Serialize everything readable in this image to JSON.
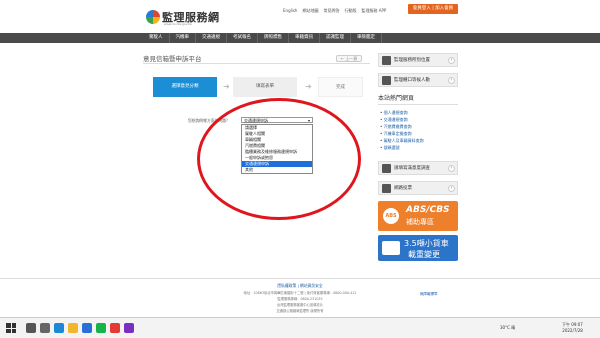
{
  "header": {
    "logo_text": "監理服務網",
    "logo_sub": "www.mvdis.gov.tw",
    "top_links": [
      "English",
      "網站地圖",
      "常見問答",
      "行動版",
      "監理服務 APP"
    ],
    "member_button": "會員登入 | 加入會員"
  },
  "nav": {
    "items": [
      "駕駛人",
      "汽機車",
      "交通違規",
      "考試報名",
      "牌照標售",
      "車籍資訊",
      "認識監理",
      "車險鑑定"
    ]
  },
  "main": {
    "title": "意見信箱暨申訴平台",
    "back_button": "← 上一頁",
    "steps": [
      "選擇意見分類",
      "填寫表單",
      "完成"
    ],
    "form_label": "您想詢問哪方面的問題？",
    "select_value": "交通違規申訴",
    "dropdown_options": [
      "請選擇",
      "駕駛人相關",
      "車輛相關",
      "汽燃費相關",
      "臨櫃業務及維修服務違規申訴",
      "一般申訴或抱怨",
      "交通違規申訴",
      "其他"
    ],
    "selected_index": 6
  },
  "sidebar": {
    "buttons": [
      "監理服務所別位置",
      "監理櫃口等候人數"
    ],
    "hot_title": "本站熱門網頁",
    "hot_links": [
      "個人違規查詢",
      "交通違規查詢",
      "汽燃費繳費查詢",
      "汽機車定檢查詢",
      "駕駛人及車輛資料查詢",
      "號碼選號"
    ],
    "survey_button": "請填寫滿意度調查",
    "vote_button": "網路投票",
    "banner_abs": {
      "circle": "ABS",
      "title": "ABS/CBS",
      "subtitle": "補助專區"
    },
    "banner_truck": {
      "title": "3.5噸小貨車",
      "subtitle": "載重變更"
    }
  },
  "footer": {
    "links": "隱私權政策 | 網站資訊安全",
    "lines": [
      "地址：10863臺北市萬華區東園街十二號 | 免付費客服專線：0800-000-412",
      "監理服務專線：0800-231035",
      "台灣監理服務客服中心宣導影片",
      "交通部公路總局監理所 版權所有"
    ],
    "badge": "無障礙標章"
  },
  "taskbar": {
    "weather": "30°C 晴",
    "time": "下午 09:07",
    "date": "2022/7/28",
    "icons": [
      {
        "name": "search",
        "color": "#555555"
      },
      {
        "name": "task-view",
        "color": "#666666"
      },
      {
        "name": "edge",
        "color": "#1e88d8"
      },
      {
        "name": "explorer",
        "color": "#f2b52c"
      },
      {
        "name": "store",
        "color": "#2a6fd6"
      },
      {
        "name": "line",
        "color": "#16b34a"
      },
      {
        "name": "chrome",
        "color": "#e53935"
      },
      {
        "name": "app",
        "color": "#7b2fbf"
      }
    ]
  }
}
